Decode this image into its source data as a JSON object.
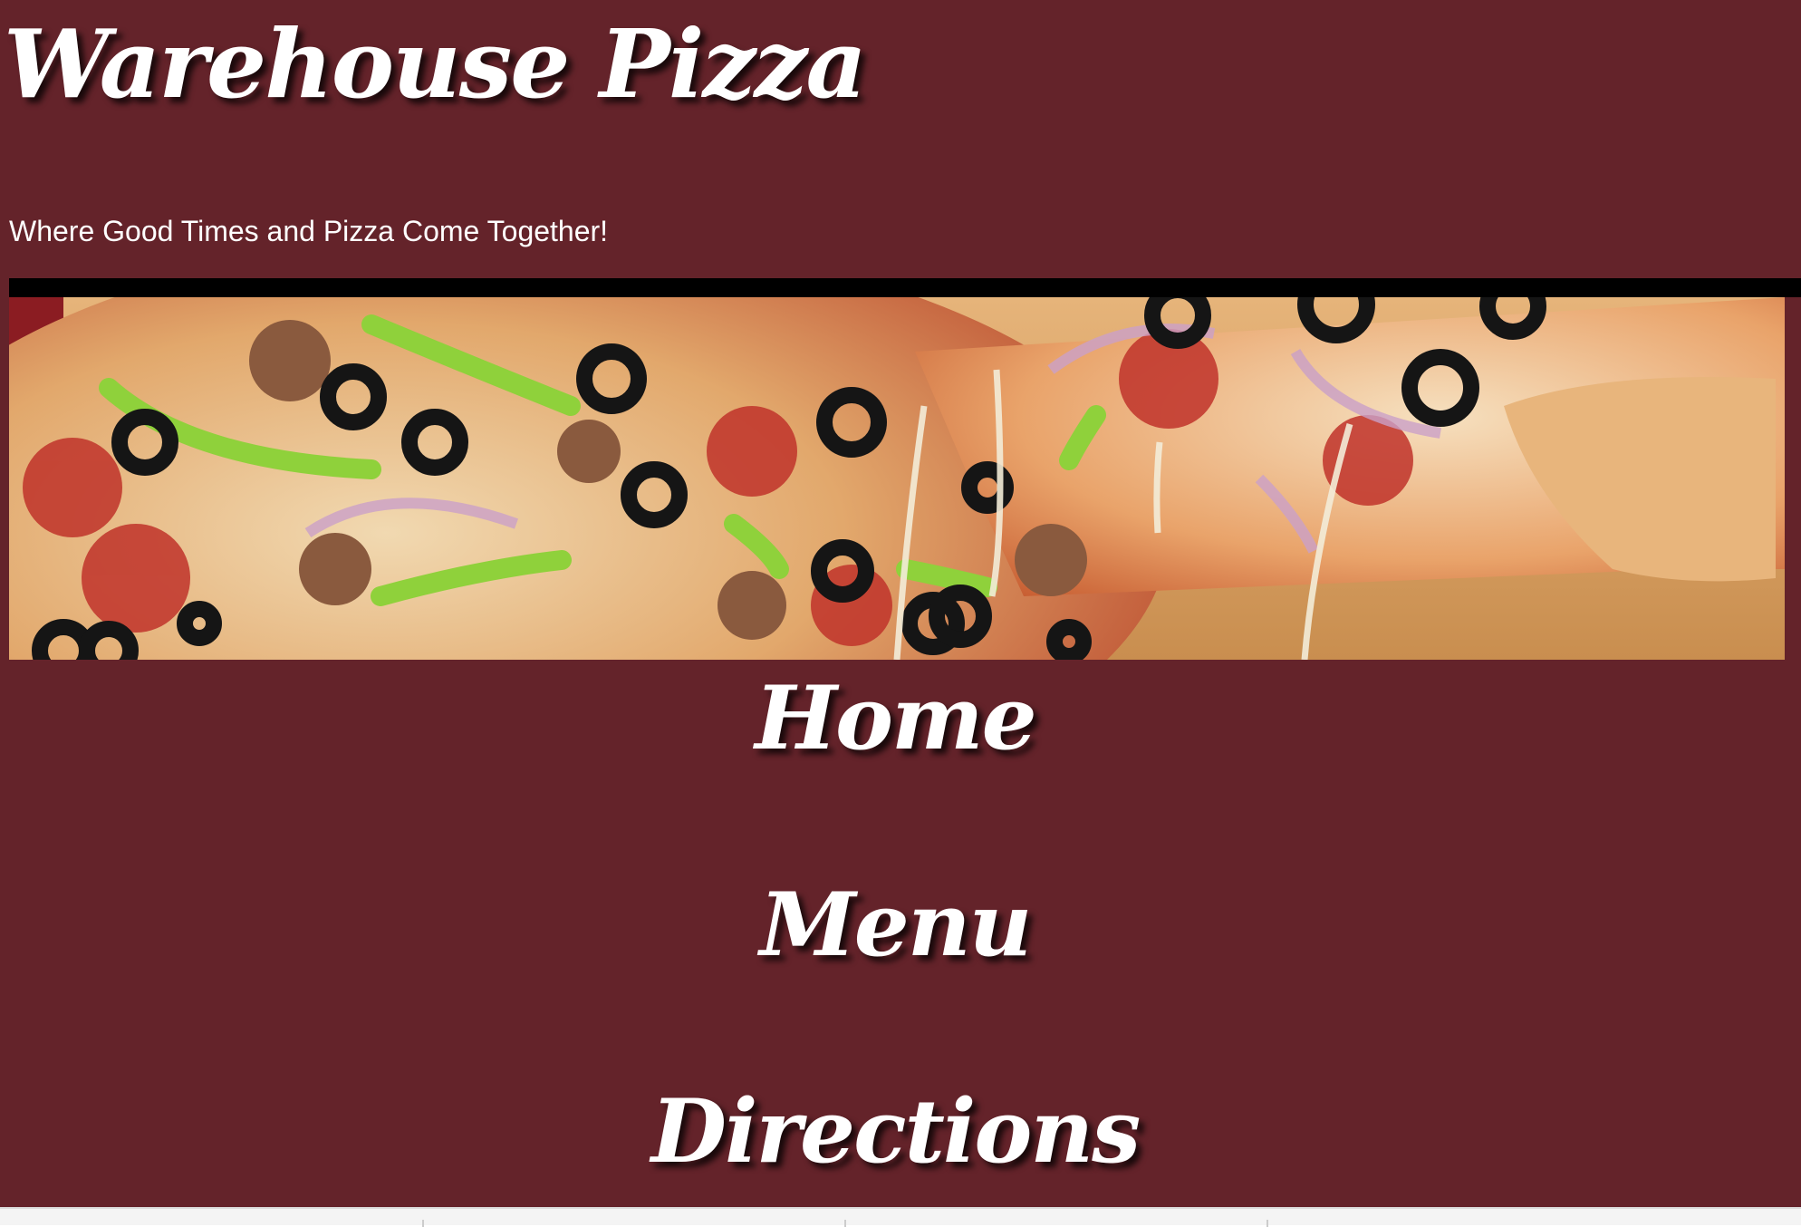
{
  "site": {
    "title": "Warehouse Pizza",
    "tagline": "Where Good Times and Pizza Come Together!"
  },
  "hero": {
    "image_description": "pizza-hero-image"
  },
  "nav": {
    "items": [
      {
        "label": "Home"
      },
      {
        "label": "Menu"
      },
      {
        "label": "Directions"
      }
    ]
  },
  "colors": {
    "background": "#64232a",
    "text": "#ffffff",
    "rule": "#000000"
  }
}
